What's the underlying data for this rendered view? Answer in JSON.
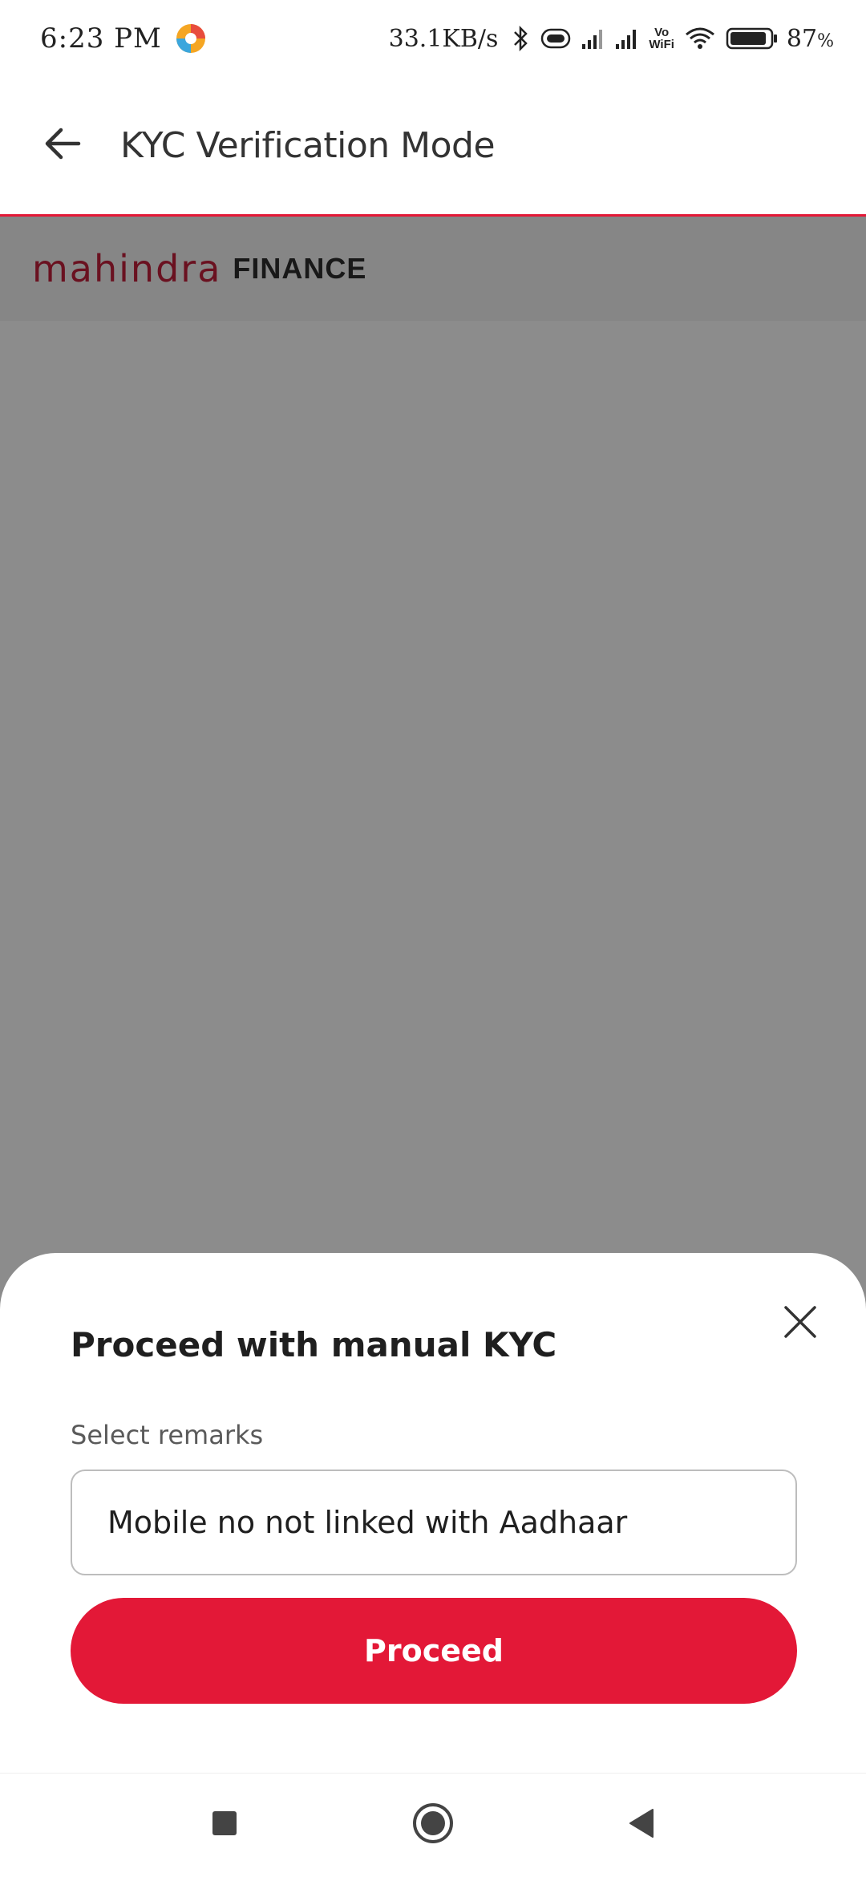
{
  "status_bar": {
    "time": "6:23 PM",
    "network_speed": "33.1KB/s",
    "vowifi_top": "Vo",
    "vowifi_bottom": "WiFi",
    "battery_level": "87",
    "battery_unit": "%",
    "icons": [
      "app-notification-icon",
      "bluetooth-icon",
      "vibrate-icon",
      "signal-icon",
      "signal-icon",
      "vowifi-icon",
      "wifi-icon",
      "battery-icon"
    ]
  },
  "app_bar": {
    "title": "KYC Verification Mode",
    "back_icon": "arrow-left-icon"
  },
  "brand": {
    "name_primary": "mahindra",
    "name_secondary": "FINANCE"
  },
  "sheet": {
    "title": "Proceed with manual KYC",
    "remarks_label": "Select remarks",
    "remarks_value": "Mobile no not linked with Aadhaar",
    "proceed_label": "Proceed",
    "close_icon": "close-icon"
  },
  "nav_bar": {
    "icons": [
      "recents-square-icon",
      "home-circle-icon",
      "back-triangle-icon"
    ]
  },
  "colors": {
    "accent": "#e31837",
    "brand_red": "#c2203b",
    "scrim": "rgba(0,0,0,0.45)"
  }
}
